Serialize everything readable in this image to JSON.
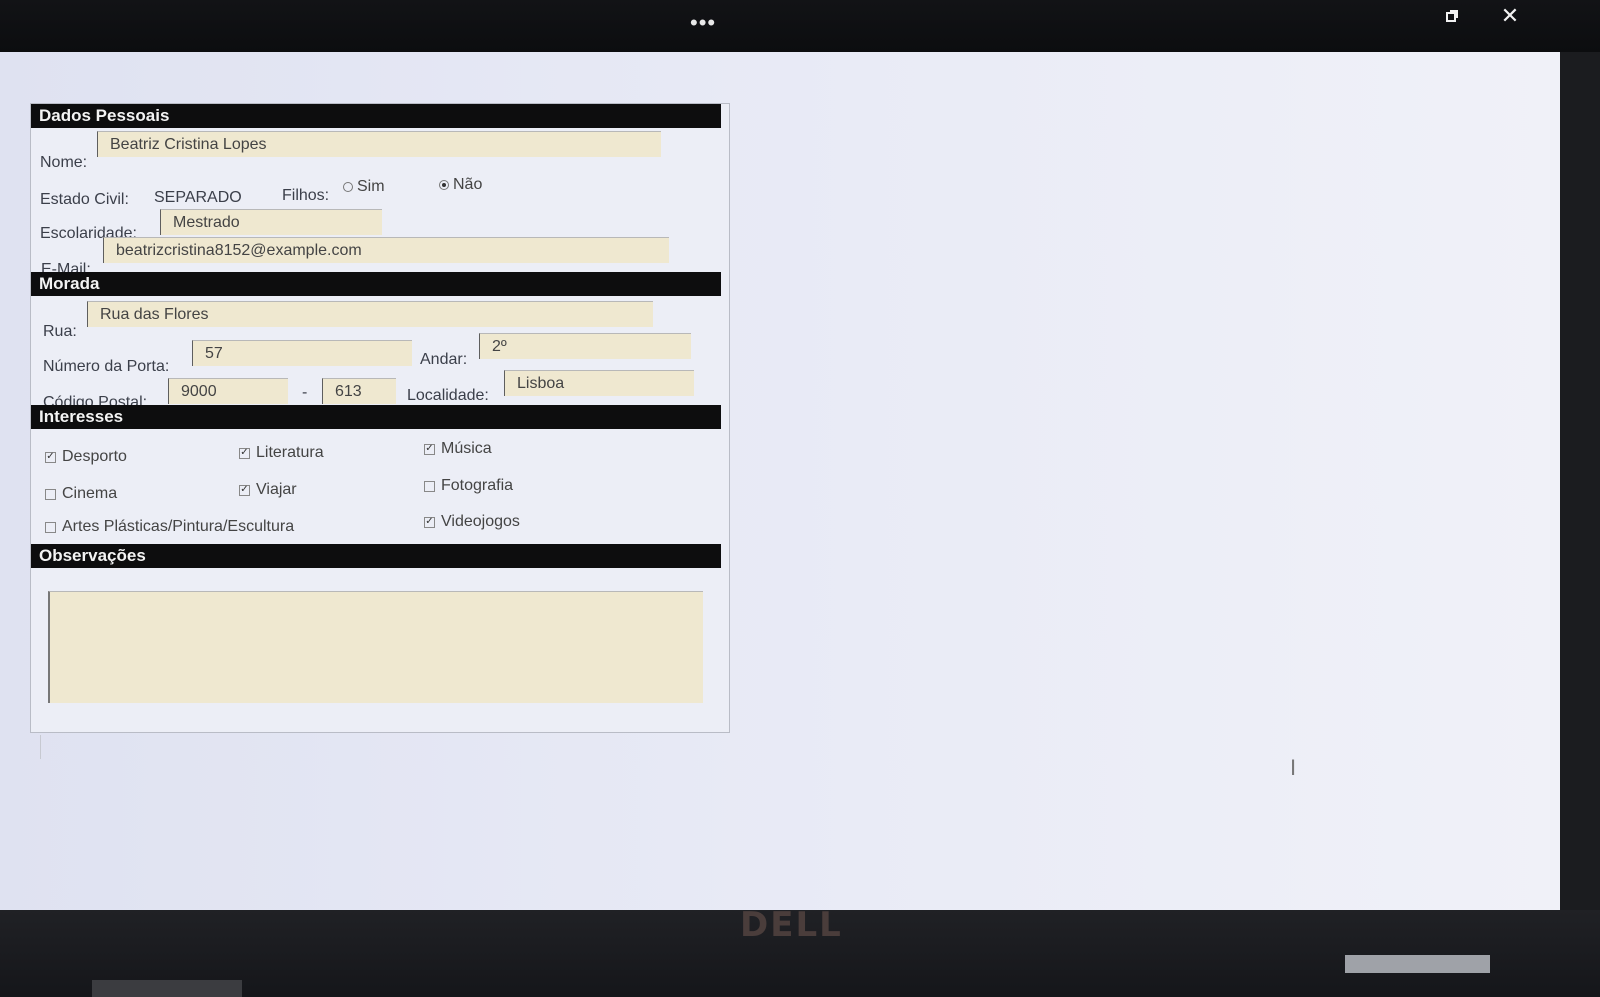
{
  "window": {
    "menu_icon": "more-dots-icon",
    "restore_icon": "restore-window-icon",
    "close_icon": "close-icon"
  },
  "device": {
    "brand": "DELL"
  },
  "sections": {
    "personal": "Dados Pessoais",
    "address": "Morada",
    "interests": "Interesses",
    "notes": "Observações"
  },
  "personal": {
    "name_label": "Nome:",
    "name_value": "Beatriz Cristina Lopes",
    "civil_label": "Estado Civil:",
    "civil_value": "SEPARADO",
    "children_label": "Filhos:",
    "children_yes": "Sim",
    "children_no": "Não",
    "children_selected": "Não",
    "education_label": "Escolaridade:",
    "education_value": "Mestrado",
    "email_label": "E-Mail:",
    "email_value": "beatrizcristina8152@example.com"
  },
  "address": {
    "street_label": "Rua:",
    "street_value": "Rua das Flores",
    "door_label": "Número da Porta:",
    "door_value": "57",
    "floor_label": "Andar:",
    "floor_value": "2º",
    "postal_label": "Código Postal:",
    "postal_first": "9000",
    "postal_separator": "-",
    "postal_second": "613",
    "locality_label": "Localidade:",
    "locality_value": "Lisboa"
  },
  "interests": [
    {
      "label": "Desporto",
      "checked": true
    },
    {
      "label": "Literatura",
      "checked": true
    },
    {
      "label": "Música",
      "checked": true
    },
    {
      "label": "Cinema",
      "checked": false
    },
    {
      "label": "Viajar",
      "checked": true
    },
    {
      "label": "Fotografia",
      "checked": false
    },
    {
      "label": "Artes Plásticas/Pintura/Escultura",
      "checked": false
    },
    {
      "label": "Videojogos",
      "checked": true
    }
  ],
  "notes": {
    "value": ""
  }
}
